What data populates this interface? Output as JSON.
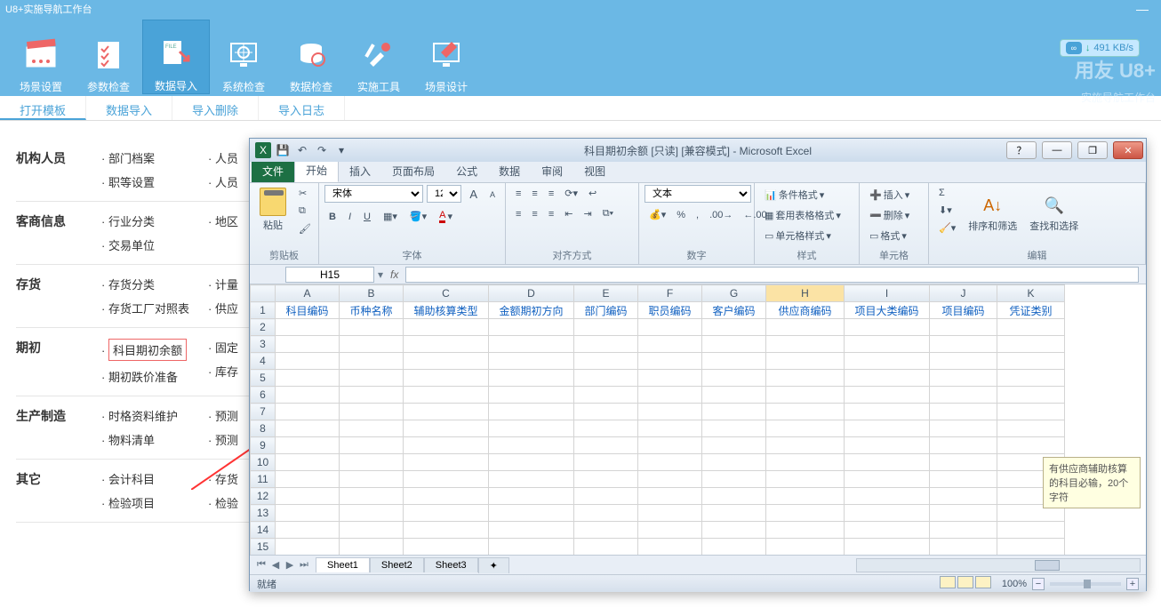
{
  "titlebar": "U8+实施导航工作台",
  "ribbon": {
    "items": [
      {
        "label": "场景设置"
      },
      {
        "label": "参数检查"
      },
      {
        "label": "数据导入"
      },
      {
        "label": "系统检查"
      },
      {
        "label": "数据检查"
      },
      {
        "label": "实施工具"
      },
      {
        "label": "场景设计"
      }
    ],
    "speed": "491 KB/s",
    "brand": "用友 U8+",
    "brand_sub": "实施导航工作台"
  },
  "subtabs": [
    "打开模板",
    "数据导入",
    "导入删除",
    "导入日志"
  ],
  "categories": [
    {
      "name": "机构人员",
      "col1": [
        "部门档案",
        "职等设置"
      ],
      "col2": [
        "人员",
        "人员"
      ]
    },
    {
      "name": "客商信息",
      "col1": [
        "行业分类",
        "交易单位"
      ],
      "col2": [
        "地区"
      ]
    },
    {
      "name": "存货",
      "col1": [
        "存货分类",
        "存货工厂对照表"
      ],
      "col2": [
        "计量",
        "供应"
      ]
    },
    {
      "name": "期初",
      "col1": [
        "科目期初余额",
        "期初跌价准备"
      ],
      "col2": [
        "固定",
        "库存"
      ]
    },
    {
      "name": "生产制造",
      "col1": [
        "时格资料维护",
        "物料清单"
      ],
      "col2": [
        "预测",
        "预测"
      ]
    },
    {
      "name": "其它",
      "col1": [
        "会计科目",
        "检验项目"
      ],
      "col2": [
        "存货",
        "检验"
      ]
    }
  ],
  "excel": {
    "title": "科目期初余额 [只读] [兼容模式] - Microsoft Excel",
    "qat": {
      "save": "💾",
      "undo": "↶",
      "redo": "↷",
      "more": "▾"
    },
    "winbtns": {
      "help": "？",
      "min": "—",
      "rest": "❐",
      "close": "✕"
    },
    "tabs": {
      "file": "文件",
      "home": "开始",
      "insert": "插入",
      "layout": "页面布局",
      "formula": "公式",
      "data": "数据",
      "review": "审阅",
      "view": "视图"
    },
    "ribbon_groups": {
      "clipboard": {
        "label": "剪贴板",
        "paste": "粘贴",
        "cut": "✂",
        "copy": "⧉",
        "brush": "🖌"
      },
      "font": {
        "label": "字体",
        "name": "宋体",
        "size": "12",
        "bold": "B",
        "italic": "I",
        "underline": "U",
        "grow": "A",
        "shrink": "A"
      },
      "align": {
        "label": "对齐方式"
      },
      "number": {
        "label": "数字",
        "fmt": "文本"
      },
      "styles": {
        "label": "样式",
        "cond": "条件格式",
        "table": "套用表格格式",
        "cell": "单元格样式"
      },
      "cells": {
        "label": "单元格",
        "insert": "插入",
        "delete": "删除",
        "format": "格式"
      },
      "editing": {
        "label": "编辑",
        "sum": "Σ",
        "sort": "排序和筛选",
        "find": "查找和选择"
      }
    },
    "namebox": "H15",
    "fx": "fx",
    "columns": [
      "A",
      "B",
      "C",
      "D",
      "E",
      "F",
      "G",
      "H",
      "I",
      "J",
      "K"
    ],
    "headers_row": [
      "科目编码",
      "币种名称",
      "辅助核算类型",
      "金额期初方向",
      "部门编码",
      "职员编码",
      "客户编码",
      "供应商编码",
      "项目大类编码",
      "项目编码",
      "凭证类别"
    ],
    "row_count": 15,
    "tooltip": "有供应商辅助核算的科目必输，20个字符",
    "sheets": [
      "Sheet1",
      "Sheet2",
      "Sheet3"
    ],
    "status": "就绪",
    "zoom": "100%"
  }
}
